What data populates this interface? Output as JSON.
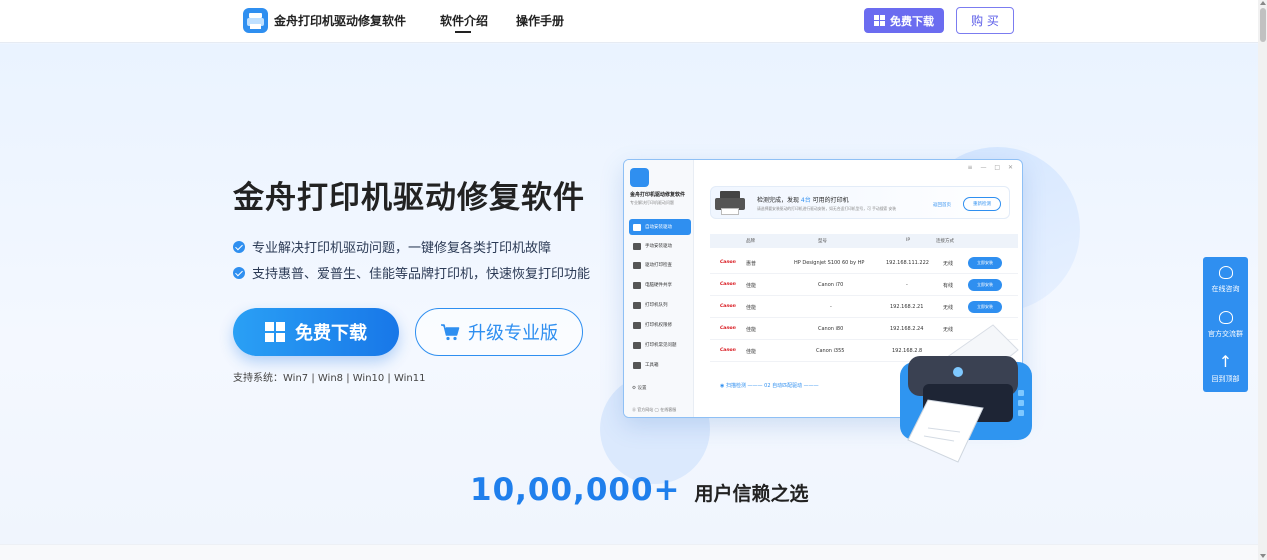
{
  "nav": {
    "brand": "金舟打印机驱动修复软件",
    "links": [
      {
        "label": "软件介绍",
        "active": true
      },
      {
        "label": "操作手册",
        "active": false
      }
    ],
    "download_label": "免费下载",
    "buy_label": "购 买"
  },
  "hero": {
    "title": "金舟打印机驱动修复软件",
    "features": [
      "专业解决打印机驱动问题，一键修复各类打印机故障",
      "支持惠普、爱普生、佳能等品牌打印机，快速恢复打印功能"
    ],
    "free_download_label": "免费下载",
    "upgrade_label": "升级专业版",
    "system_requirements": "支持系统：Win7 | Win8 | Win10 | Win11"
  },
  "app_preview": {
    "app_name": "金舟打印机驱动修复软件",
    "app_subtitle": "专业解决打印机驱动问题",
    "window_controls": "≡ — □ ✕",
    "sidebar": [
      "自动安装驱动",
      "手动安装驱动",
      "驱动打印检查",
      "电脑硬件共享",
      "打印机队列",
      "打印机权限修",
      "打印机常见问题",
      "工具箱"
    ],
    "settings_label": "⚙ 设置",
    "footer": "⓪ 官方网站   ◯ 在线客服",
    "detect_title_pre": "检测完成，发现 ",
    "detect_count": "4台",
    "detect_title_post": " 可用的打印机",
    "detect_desc": "请选择要安装驱动的打印机进行驱动安装，如无合适打印机型号，可 手动搜索 安装",
    "detect_link": "返回首页",
    "detect_button": "重新检测",
    "table_headers": [
      "品牌",
      "型号",
      "IP",
      "连接方式"
    ],
    "rows": [
      {
        "brand": "Canon",
        "brand_cn": "惠普",
        "model": "HP Designjet S100 60 by HP",
        "ip": "192.168.111.222",
        "conn": "无线",
        "action": "立即安装"
      },
      {
        "brand": "Canon",
        "brand_cn": "佳能",
        "model": "Canon i70",
        "ip": "-",
        "conn": "有线",
        "action": "立即安装"
      },
      {
        "brand": "Canon",
        "brand_cn": "佳能",
        "model": "-",
        "ip": "192.168.2.21",
        "conn": "无线",
        "action": "立即安装"
      },
      {
        "brand": "Canon",
        "brand_cn": "佳能",
        "model": "Canon i80",
        "ip": "192.168.2.24",
        "conn": "无线",
        "action": "立即安装"
      },
      {
        "brand": "Canon",
        "brand_cn": "佳能",
        "model": "Canon i355",
        "ip": "192.168.2.8",
        "conn": "无线",
        "action": "立即安装"
      }
    ],
    "steps": "◉ 扫描检测 ——— 02 自动匹配驱动 ———"
  },
  "side_rail": {
    "items": [
      "在线咨询",
      "官方交流群",
      "回到顶部"
    ]
  },
  "stats": {
    "number": "10,00,000+",
    "label": "用户信赖之选"
  },
  "colors": {
    "primary": "#2f8ff0",
    "purple": "#6b6cf0",
    "stat": "#1f7fec"
  }
}
